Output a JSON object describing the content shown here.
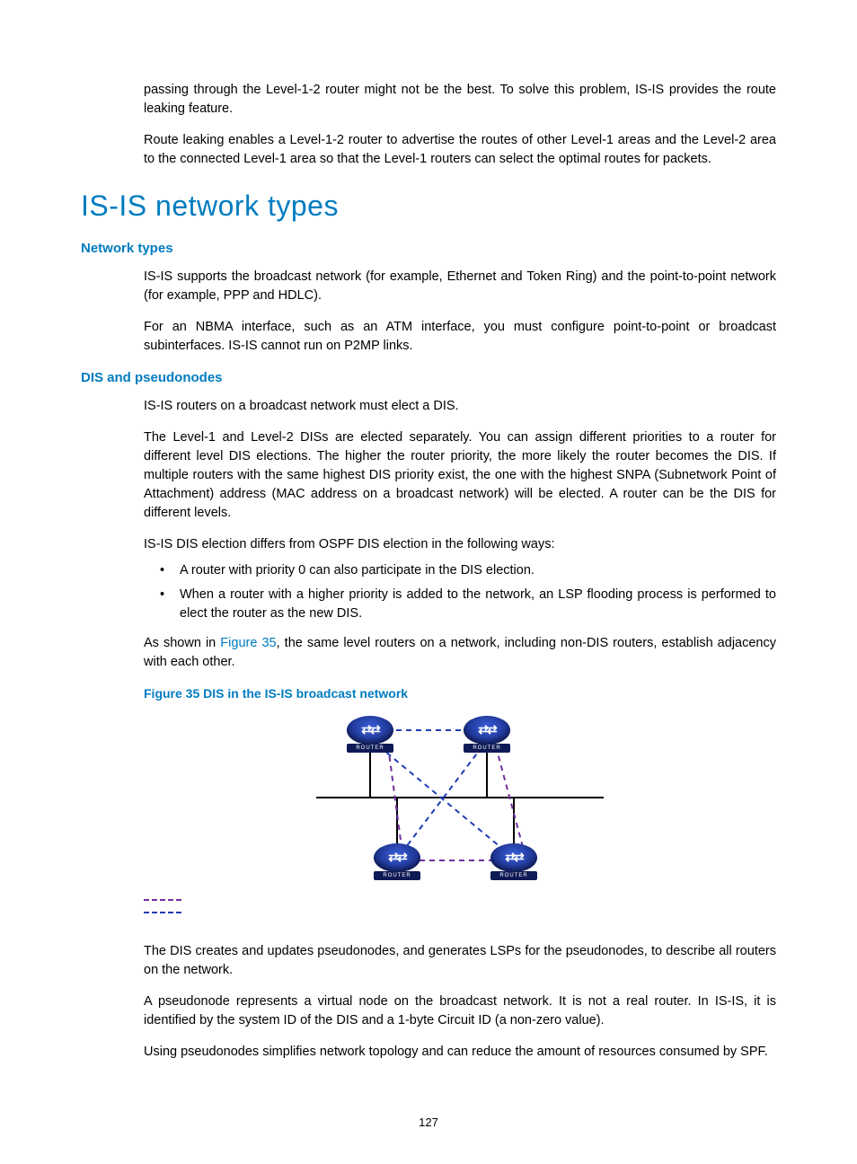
{
  "intro": {
    "p1": "passing through the Level-1-2 router might not be the best. To solve this problem, IS-IS provides the route leaking feature.",
    "p2": "Route leaking enables a Level-1-2 router to advertise the routes of other Level-1 areas and the Level-2 area to the connected Level-1 area so that the Level-1 routers can select the optimal routes for packets."
  },
  "h1": "IS-IS network types",
  "network_types": {
    "heading": "Network types",
    "p1": "IS-IS supports the broadcast network (for example, Ethernet and Token Ring) and the point-to-point network (for example, PPP and HDLC).",
    "p2": "For an NBMA interface, such as an ATM interface, you must configure point-to-point or broadcast subinterfaces. IS-IS cannot run on P2MP links."
  },
  "dis": {
    "heading": "DIS and pseudonodes",
    "p1": "IS-IS routers on a broadcast network must elect a DIS.",
    "p2": "The Level-1 and Level-2 DISs are elected separately. You can assign different priorities to a router for different level DIS elections. The higher the router priority, the more likely the router becomes the DIS. If multiple routers with the same highest DIS priority exist, the one with the highest SNPA (Subnetwork Point of Attachment) address (MAC address on a broadcast network) will be elected. A router can be the DIS for different levels.",
    "p3": "IS-IS DIS election differs from OSPF DIS election in the following ways:",
    "bullets": [
      "A router with priority 0 can also participate in the DIS election.",
      "When a router with a higher priority is added to the network, an LSP flooding process is performed to elect the router as the new DIS."
    ],
    "p4_pre": "As shown in ",
    "p4_ref": "Figure 35",
    "p4_post": ", the same level routers on a network, including non-DIS routers, establish adjacency with each other.",
    "figcap": "Figure 35 DIS in the IS-IS broadcast network",
    "p5": "The DIS creates and updates pseudonodes, and generates LSPs for the pseudonodes, to describe all routers on the network.",
    "p6": "A pseudonode represents a virtual node on the broadcast network. It is not a real router. In IS-IS, it is identified by the system ID of the DIS and a 1-byte Circuit ID (a non-zero value).",
    "p7": "Using pseudonodes simplifies network topology and can reduce the amount of resources consumed by SPF."
  },
  "router_label": "ROUTER",
  "router_glyph": "⇄⇄",
  "page_number": "127",
  "colors": {
    "accent": "#007cc0",
    "dash_purple": "#7030a0",
    "dash_blue": "#1f3db5"
  }
}
